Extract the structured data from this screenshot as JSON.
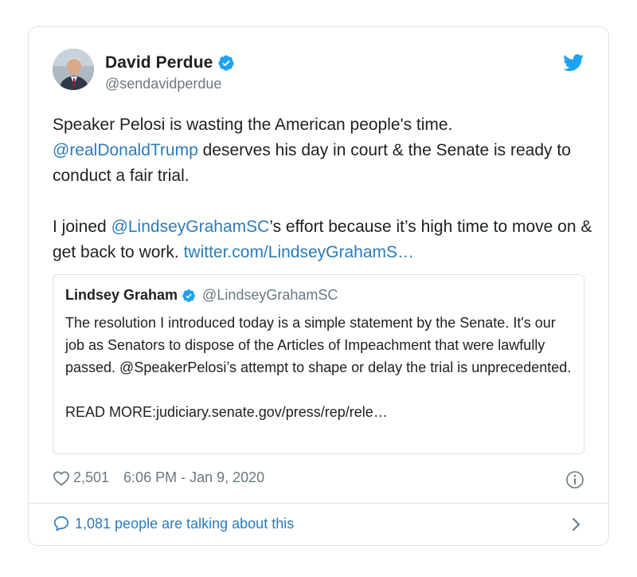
{
  "author": {
    "display_name": "David Perdue",
    "handle": "@sendavidperdue",
    "verified": true
  },
  "tweet": {
    "paragraph1": {
      "line1": "Speaker Pelosi is wasting the American people's time.",
      "mention": "@realDonaldTrump",
      "after_mention": " deserves his day in court & the Senate is ready to conduct a fair trial."
    },
    "paragraph2": {
      "before_mention": "I joined ",
      "mention": "@LindseyGrahamSC",
      "after_mention": "’s effort because it’s high time to move on & get back to work. ",
      "link": "twitter.com/LindseyGrahamS…"
    }
  },
  "quoted_tweet": {
    "display_name": "Lindsey Graham",
    "handle": "@LindseyGrahamSC",
    "verified": true,
    "text": "The resolution I introduced today is a simple statement by the Senate.  It's our job as Senators to dispose of the Articles of Impeachment that were lawfully passed. @SpeakerPelosi’s attempt to shape or delay the trial is unprecedented.",
    "read_more": "READ MORE:judiciary.senate.gov/press/rep/rele…"
  },
  "meta": {
    "like_count": "2,501",
    "timestamp": "6:06 PM - Jan 9, 2020"
  },
  "footer": {
    "talking_text": "1,081 people are talking about this"
  },
  "icons": {
    "brand": "twitter-bird-icon",
    "verified": "verified-badge-icon",
    "like": "heart-icon",
    "info": "info-icon",
    "reply": "speech-bubble-icon",
    "chevron": "chevron-right-icon"
  },
  "colors": {
    "brand_blue": "#1da1f2",
    "link_blue": "#2b7bb9",
    "text_primary": "#1c2022",
    "text_secondary": "#697882",
    "border": "#dce3e8"
  }
}
